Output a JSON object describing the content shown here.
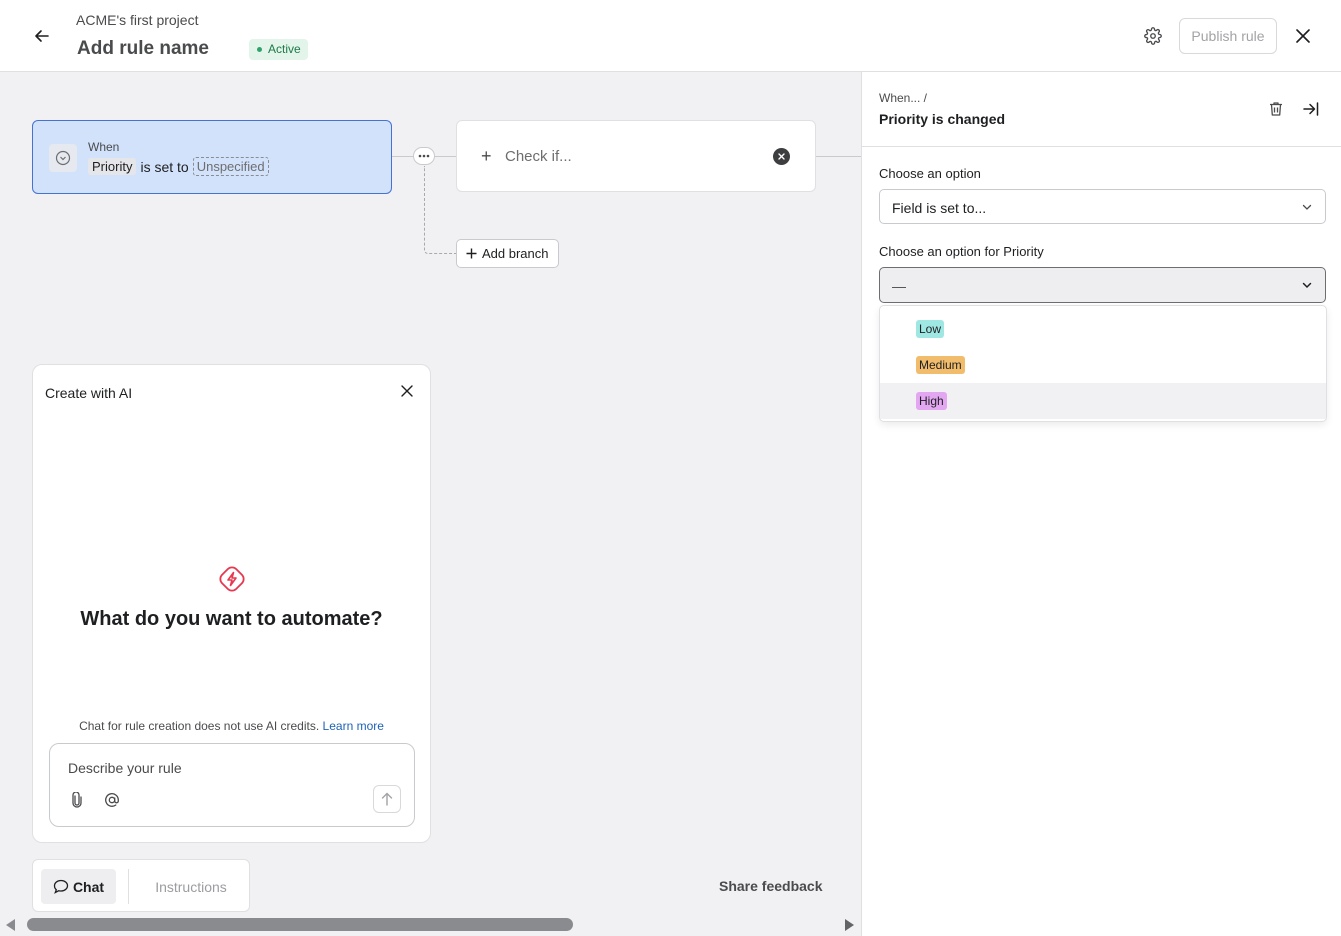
{
  "header": {
    "project_name": "ACME's first project",
    "rule_name": "Add rule name",
    "status": "Active",
    "publish_label": "Publish rule"
  },
  "canvas": {
    "trigger": {
      "when_label": "When",
      "field": "Priority",
      "connector_text": "is set to",
      "value": "Unspecified"
    },
    "check": {
      "label": "Check if..."
    },
    "add_branch_label": "Add branch"
  },
  "ai_panel": {
    "title": "Create with AI",
    "heading": "What do you want to automate?",
    "note": "Chat for rule creation does not use AI credits.",
    "learn_more": "Learn more",
    "input_placeholder": "Describe your rule"
  },
  "bottom_bar": {
    "chat_label": "Chat",
    "instructions_label": "Instructions",
    "share_feedback": "Share feedback"
  },
  "side_panel": {
    "breadcrumb": "When...  /",
    "title": "Priority is changed",
    "option_label": "Choose an option",
    "option_value": "Field is set to...",
    "priority_label": "Choose an option for Priority",
    "priority_value": "—",
    "priority_options": [
      {
        "label": "Low",
        "color": "#9ee7e3"
      },
      {
        "label": "Medium",
        "color": "#f1bd6c"
      },
      {
        "label": "High",
        "color": "#e3a6f1"
      }
    ]
  },
  "colors": {
    "accent": "#4573d2",
    "trigger_bg": "#d3e2fb",
    "active_green": "#1c7a45",
    "ai_bolt": "#e8384f"
  }
}
